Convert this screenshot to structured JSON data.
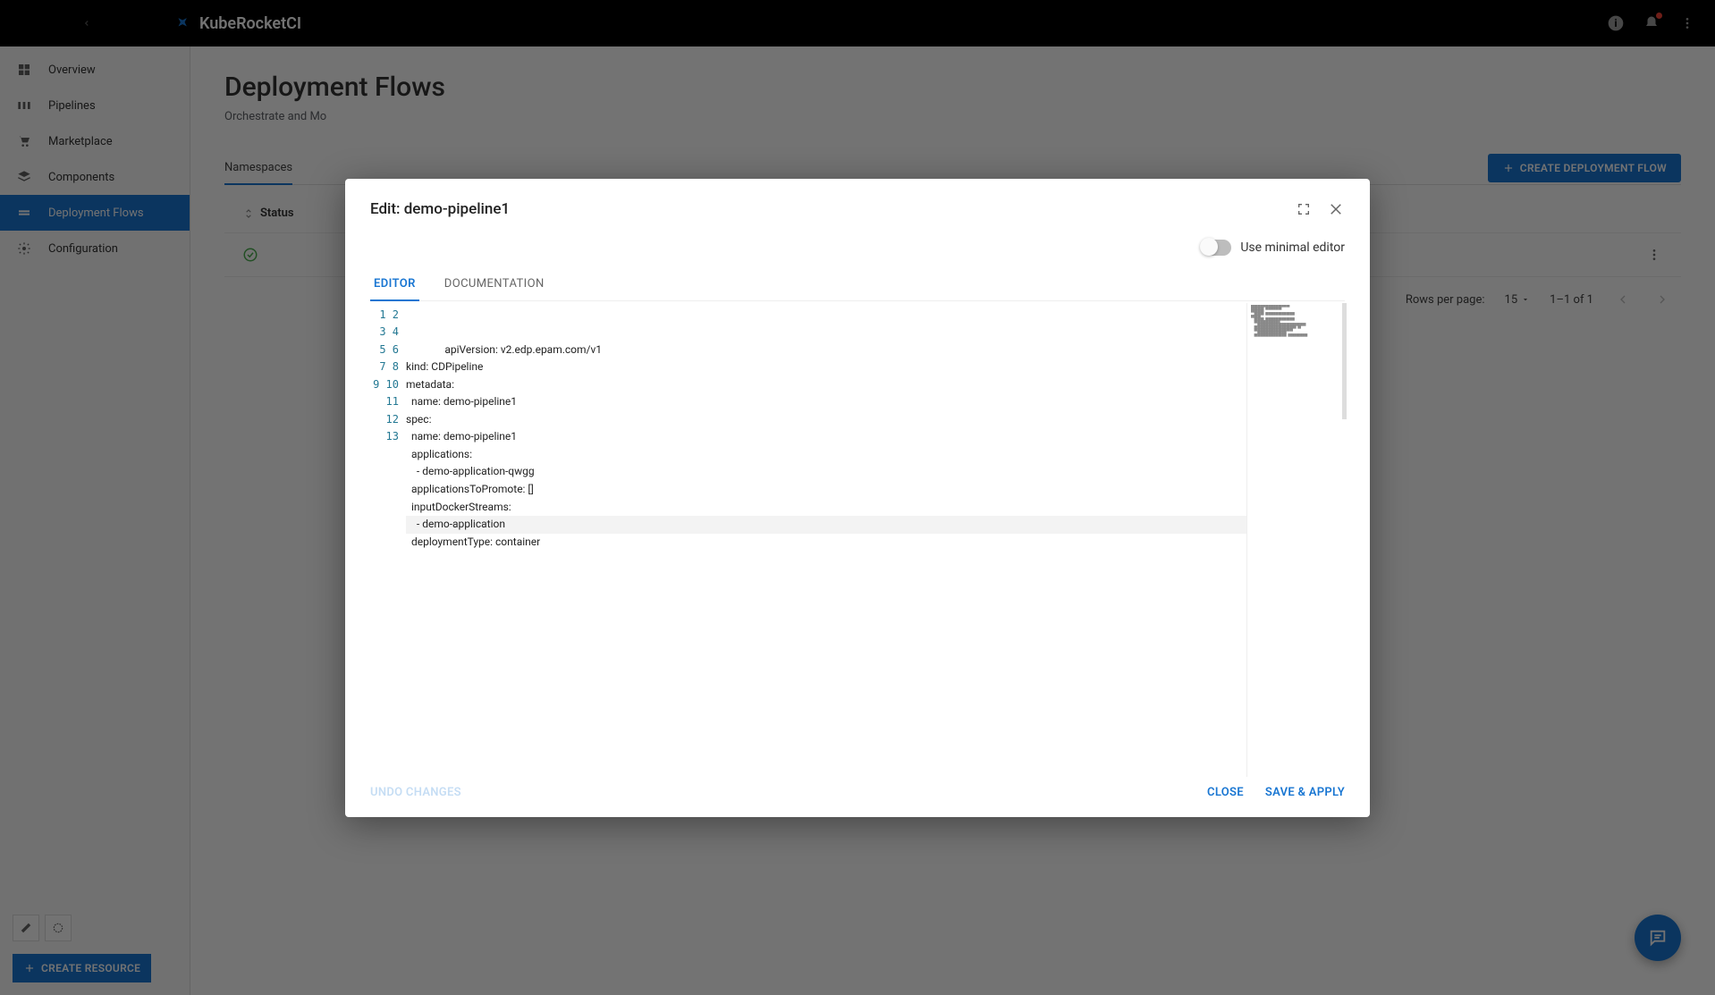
{
  "brand": {
    "name": "KubeRocketCI"
  },
  "sidebar": {
    "items": [
      {
        "label": "Overview"
      },
      {
        "label": "Pipelines"
      },
      {
        "label": "Marketplace"
      },
      {
        "label": "Components"
      },
      {
        "label": "Deployment Flows"
      },
      {
        "label": "Configuration"
      }
    ],
    "create_resource": "CREATE RESOURCE"
  },
  "page": {
    "title": "Deployment Flows",
    "subtitle_truncated": "Orchestrate and Mo",
    "namespaces_tab": "Namespaces",
    "create_flow_btn": "CREATE DEPLOYMENT FLOW",
    "columns": {
      "status": "Status"
    },
    "pager": {
      "rows_label": "Rows per page:",
      "rows_value": "15",
      "range": "1–1 of 1"
    }
  },
  "modal": {
    "title": "Edit: demo-pipeline1",
    "toggle_label": "Use minimal editor",
    "tabs": {
      "editor": "EDITOR",
      "documentation": "DOCUMENTATION"
    },
    "code_text": "apiVersion: v2.edp.epam.com/v1\nkind: CDPipeline\nmetadata:\n  name: demo-pipeline1\nspec:\n  name: demo-pipeline1\n  applications:\n    - demo-application-qwgg\n  applicationsToPromote: []\n  inputDockerStreams:\n    - demo-application\n  deploymentType: container\n",
    "line_numbers": "1\n2\n3\n4\n5\n6\n7\n8\n9\n10\n11\n12\n13",
    "buttons": {
      "undo": "UNDO CHANGES",
      "close": "CLOSE",
      "save": "SAVE & APPLY"
    }
  }
}
